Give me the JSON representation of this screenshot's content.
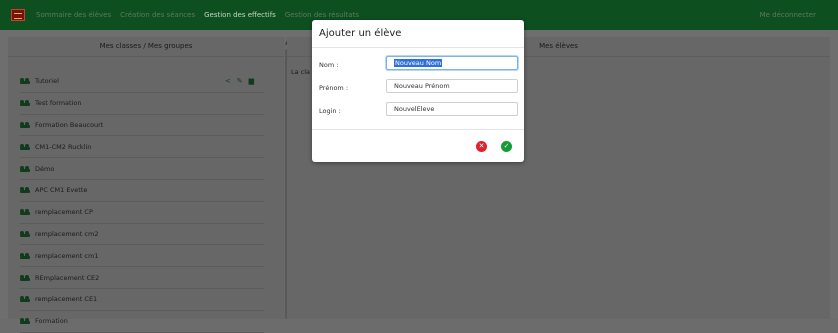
{
  "nav": {
    "links": [
      "Sommaire des élèves",
      "Création des séances",
      "Gestion des effectifs",
      "Gestion des résultats"
    ],
    "logout": "Me déconnecter"
  },
  "left_panel": {
    "title": "Mes classes / Mes groupes",
    "groups": [
      "Tutoriel",
      "Test formation",
      "Formation Beaucourt",
      "CM1-CM2 Rucklin",
      "Démo",
      "APC CM1 Evette",
      "remplacement CP",
      "remplacement cm2",
      "remplacement cm1",
      "REmplacement CE2",
      "remplacement CE1",
      "Formation"
    ]
  },
  "right_panel": {
    "title": "Mes élèves",
    "fragment": "La cla"
  },
  "modal": {
    "title": "Ajouter un élève",
    "fields": [
      {
        "label": "Nom :",
        "value": "Nouveau Nom"
      },
      {
        "label": "Prénom :",
        "value": "Nouveau Prénom"
      },
      {
        "label": "Login :",
        "value": "NouvelEleve"
      }
    ],
    "cancel_icon": "x-circle-icon",
    "confirm_icon": "check-circle-icon"
  },
  "colors": {
    "navbar": "#0e4f1f",
    "overlay": "#6e6e6e",
    "group_icon": "#123a1c",
    "cancel": "#e0202b",
    "confirm": "#159a35"
  }
}
